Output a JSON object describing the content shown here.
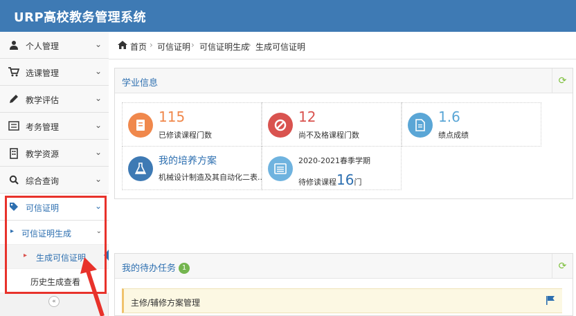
{
  "header": {
    "title": "URP高校教务管理系统"
  },
  "sidebar": {
    "items": [
      {
        "label": "个人管理",
        "icon": "user-icon"
      },
      {
        "label": "选课管理",
        "icon": "cart-icon"
      },
      {
        "label": "教学评估",
        "icon": "pencil-icon"
      },
      {
        "label": "考务管理",
        "icon": "list-icon"
      },
      {
        "label": "教学资源",
        "icon": "building-icon"
      },
      {
        "label": "综合查询",
        "icon": "search-icon"
      },
      {
        "label": "可信证明",
        "icon": "tag-icon"
      }
    ],
    "sub": {
      "label": "可信证明生成"
    },
    "leaves": [
      {
        "label": "生成可信证明"
      },
      {
        "label": "历史生成查看"
      }
    ],
    "collapse_glyph": "«"
  },
  "breadcrumb": {
    "items": [
      "首页",
      "可信证明",
      "可信证明生成",
      "生成可信证明"
    ],
    "separator": "›"
  },
  "study": {
    "title": "学业信息",
    "stats": [
      {
        "value": "115",
        "label": "已修读课程门数",
        "color": "#f0884c"
      },
      {
        "value": "12",
        "label": "尚不及格课程门数",
        "color": "#d9534f"
      },
      {
        "value": "1.6",
        "label": "绩点成绩",
        "color": "#5aa6d6"
      }
    ],
    "plan": {
      "title": "我的培养方案",
      "label": "机械设计制造及其自动化二表...",
      "color": "#3e7ab4"
    },
    "term": {
      "name": "2020-2021春季学期",
      "prefix": "待修读课程",
      "count": "16",
      "unit": "门",
      "color": "#6fb3df"
    }
  },
  "tasks": {
    "title": "我的待办任务",
    "count": "1",
    "items": [
      {
        "label": "主修/辅修方案管理"
      }
    ]
  },
  "colors": {
    "topbar": "#3e7ab4",
    "accent": "#2d6fb0",
    "highlight": "#e8322b"
  }
}
